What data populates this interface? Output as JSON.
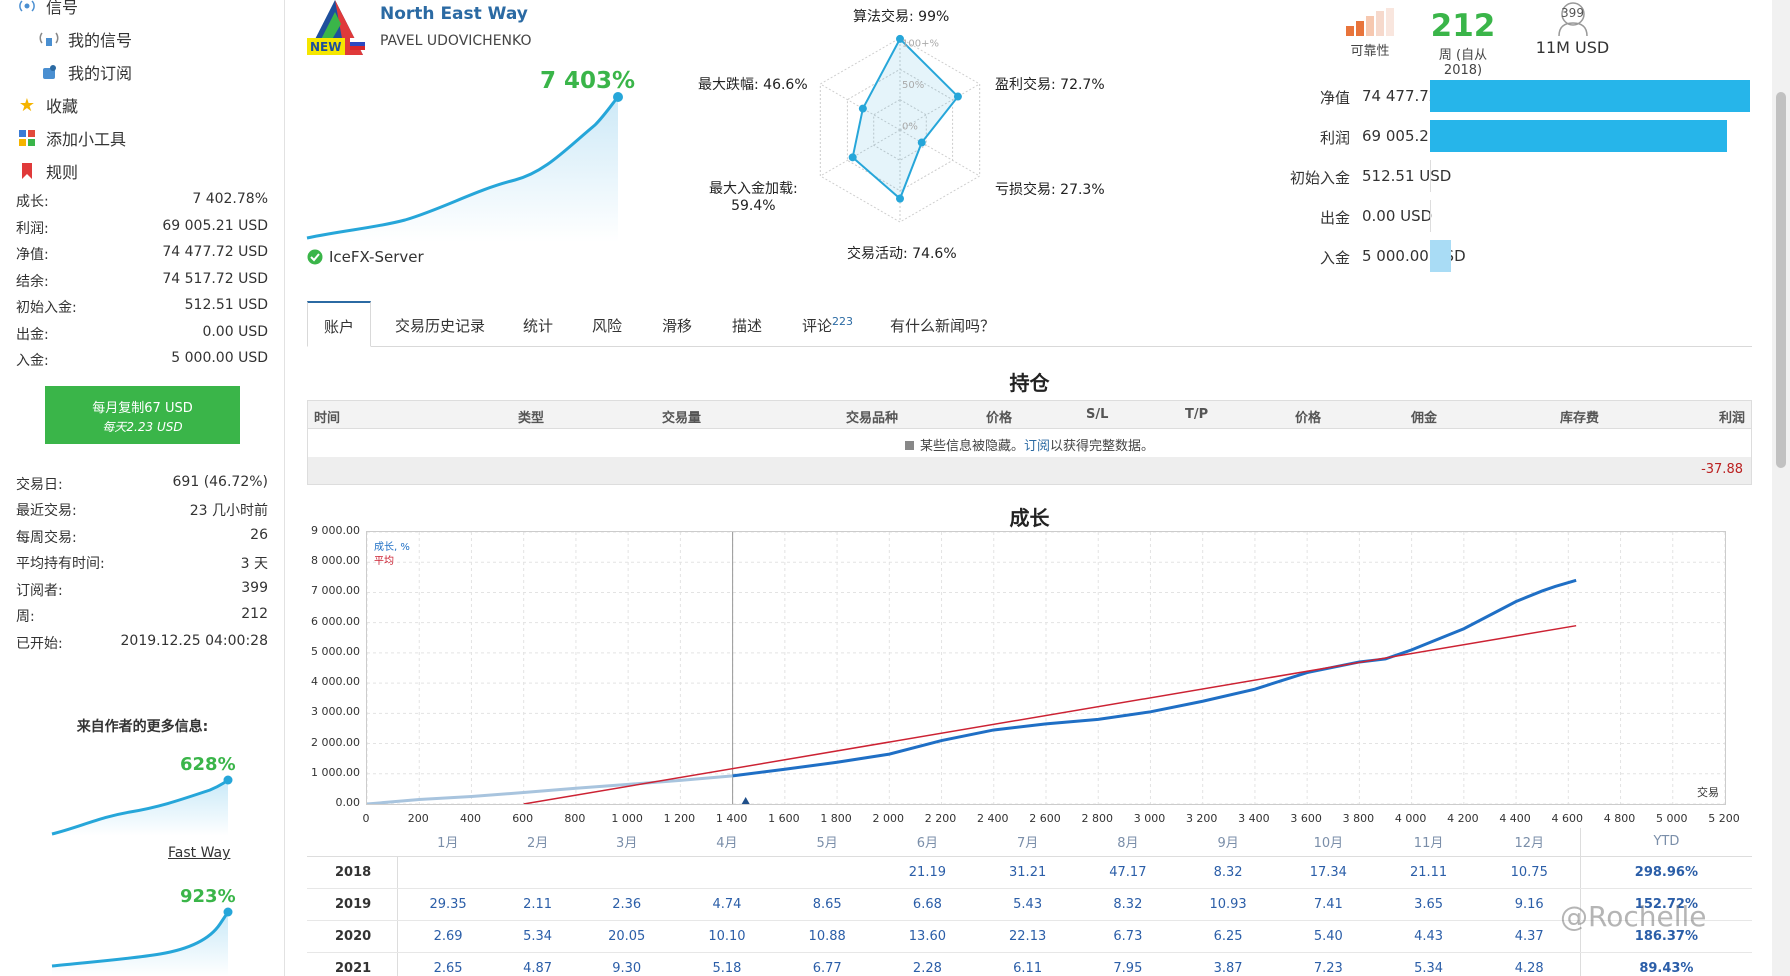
{
  "sidebar": {
    "nav": [
      {
        "label": "信号",
        "icon": "signal-icon"
      },
      {
        "label": "我的信号",
        "icon": "broadcast-icon"
      },
      {
        "label": "我的订阅",
        "icon": "subscription-icon"
      },
      {
        "label": "收藏",
        "icon": "star-icon"
      },
      {
        "label": "添加小工具",
        "icon": "widget-icon"
      },
      {
        "label": "规则",
        "icon": "bookmark-icon"
      }
    ],
    "stats": [
      {
        "label": "成长:",
        "value": "7 402.78%"
      },
      {
        "label": "利润:",
        "value": "69 005.21 USD"
      },
      {
        "label": "净值:",
        "value": "74 477.72 USD"
      },
      {
        "label": "结余:",
        "value": "74 517.72 USD"
      },
      {
        "label": "初始入金:",
        "value": "512.51 USD"
      },
      {
        "label": "出金:",
        "value": "0.00 USD"
      },
      {
        "label": "入金:",
        "value": "5 000.00 USD"
      }
    ],
    "copy_button": {
      "line1": "每月复制67 USD",
      "line2": "每天2.23 USD"
    },
    "stats2": [
      {
        "label": "交易日:",
        "value": "691 (46.72%)"
      },
      {
        "label": "最近交易:",
        "value": "23 几小时前"
      },
      {
        "label": "每周交易:",
        "value": "26"
      },
      {
        "label": "平均持有时间:",
        "value": "3 天"
      },
      {
        "label": "订阅者:",
        "value": "399"
      },
      {
        "label": "周:",
        "value": "212"
      },
      {
        "label": "已开始:",
        "value": "2019.12.25 04:00:28"
      }
    ],
    "more_title": "来自作者的更多信息:",
    "mini1": {
      "value": "628%",
      "link": "Fast Way"
    },
    "mini2": {
      "value": "923%"
    }
  },
  "signal": {
    "name": "North East Way",
    "author": "PAVEL UDOVICHENKO",
    "logo_badge": "NEW",
    "growth": "7 403%",
    "server": "IceFX-Server"
  },
  "radar": {
    "labels": {
      "algo": "算法交易: 99%",
      "profit": "盈利交易: 72.7%",
      "loss": "亏损交易: 27.3%",
      "activity": "交易活动: 74.6%",
      "load1": "最大入金加载:",
      "load2": "59.4%",
      "drawdown": "最大跌幅: 46.6%"
    },
    "rings": {
      "r100": "100+%",
      "r50": "50%",
      "r0": "0%"
    },
    "values": [
      0.99,
      0.727,
      0.273,
      0.746,
      0.594,
      0.466
    ]
  },
  "summary": {
    "reliability_label": "可靠性",
    "weeks": "212",
    "weeks_label": "周 (自从 2018)",
    "subscribers": "399",
    "funds": "11M USD"
  },
  "balances": [
    {
      "label": "净值",
      "value": "74 477.72 USD",
      "fraction": 1.0,
      "color": "#26b5ea"
    },
    {
      "label": "利润",
      "value": "69 005.21 USD",
      "fraction": 0.927,
      "color": "#26b5ea"
    },
    {
      "label": "初始入金",
      "value": "512.51 USD",
      "fraction": 0.0,
      "color": "#26b5ea"
    },
    {
      "label": "出金",
      "value": "0.00 USD",
      "fraction": 0.0,
      "color": "#26b5ea"
    },
    {
      "label": "入金",
      "value": "5 000.00 USD",
      "fraction": 0.067,
      "color": "#a9dcf5"
    }
  ],
  "tabs": [
    "账户",
    "交易历史记录",
    "统计",
    "风险",
    "滑移",
    "描述",
    "评论",
    "有什么新闻吗？"
  ],
  "tab_badge": "223",
  "positions": {
    "title": "持仓",
    "columns": [
      "时间",
      "类型",
      "交易量",
      "交易品种",
      "价格",
      "S/L",
      "T/P",
      "价格",
      "佣金",
      "库存费",
      "利润"
    ],
    "note_pre": "某些信息被隐藏。",
    "note_link": "订阅",
    "note_post": "以获得完整数据。",
    "total": "-37.88"
  },
  "growth_chart_title": "成长",
  "chart_data": {
    "type": "line",
    "title": "成长",
    "xlabel": "交易",
    "ylabel": "",
    "xlim": [
      0,
      5200
    ],
    "ylim": [
      0,
      9000
    ],
    "x_ticks": [
      "0",
      "200",
      "400",
      "600",
      "800",
      "1 000",
      "1 200",
      "1 400",
      "1 600",
      "1 800",
      "2 000",
      "2 200",
      "2 400",
      "2 600",
      "2 800",
      "3 000",
      "3 200",
      "3 400",
      "3 600",
      "3 800",
      "4 000",
      "4 200",
      "4 400",
      "4 600",
      "4 800",
      "5 000",
      "5 200"
    ],
    "y_ticks": [
      "0.00",
      "1 000.00",
      "2 000.00",
      "3 000.00",
      "4 000.00",
      "5 000.00",
      "6 000.00",
      "7 000.00",
      "8 000.00",
      "9 000.00"
    ],
    "legend": [
      "成长, %",
      "平均"
    ],
    "legend_position": "top-left",
    "series": [
      {
        "name": "成长, %",
        "color": "#1f6fc5",
        "x": [
          0,
          200,
          400,
          600,
          800,
          1000,
          1200,
          1400,
          1600,
          1800,
          2000,
          2200,
          2400,
          2600,
          2800,
          3000,
          3200,
          3400,
          3600,
          3800,
          3900,
          4000,
          4200,
          4400,
          4500,
          4550,
          4630
        ],
        "y": [
          0,
          150,
          250,
          380,
          520,
          650,
          780,
          930,
          1150,
          1380,
          1650,
          2100,
          2450,
          2650,
          2800,
          3050,
          3400,
          3800,
          4350,
          4700,
          4800,
          5100,
          5800,
          6700,
          7050,
          7200,
          7402.78
        ]
      },
      {
        "name": "平均",
        "color": "#cc2233",
        "x": [
          600,
          4630
        ],
        "y": [
          0,
          5900
        ]
      }
    ],
    "history_split_x": 1400
  },
  "year_table": {
    "months": [
      "1月",
      "2月",
      "3月",
      "4月",
      "5月",
      "6月",
      "7月",
      "8月",
      "9月",
      "10月",
      "11月",
      "12月"
    ],
    "ytd_label": "YTD",
    "rows": [
      {
        "year": "2018",
        "values": [
          "",
          "",
          "",
          "",
          "",
          "21.19",
          "31.21",
          "47.17",
          "8.32",
          "17.34",
          "21.11",
          "10.75"
        ],
        "ytd": "298.96%"
      },
      {
        "year": "2019",
        "values": [
          "29.35",
          "2.11",
          "2.36",
          "4.74",
          "8.65",
          "6.68",
          "5.43",
          "8.32",
          "10.93",
          "7.41",
          "3.65",
          "9.16"
        ],
        "ytd": "152.72%"
      },
      {
        "year": "2020",
        "values": [
          "2.69",
          "5.34",
          "20.05",
          "10.10",
          "10.88",
          "13.60",
          "22.13",
          "6.73",
          "6.25",
          "5.40",
          "4.43",
          "4.37"
        ],
        "ytd": "186.37%"
      },
      {
        "year": "2021",
        "values": [
          "2.65",
          "4.87",
          "9.30",
          "5.18",
          "6.77",
          "2.28",
          "6.11",
          "7.95",
          "3.87",
          "7.23",
          "5.34",
          "4.28"
        ],
        "ytd": "89.43%"
      }
    ]
  },
  "watermark": "@Rochelle"
}
